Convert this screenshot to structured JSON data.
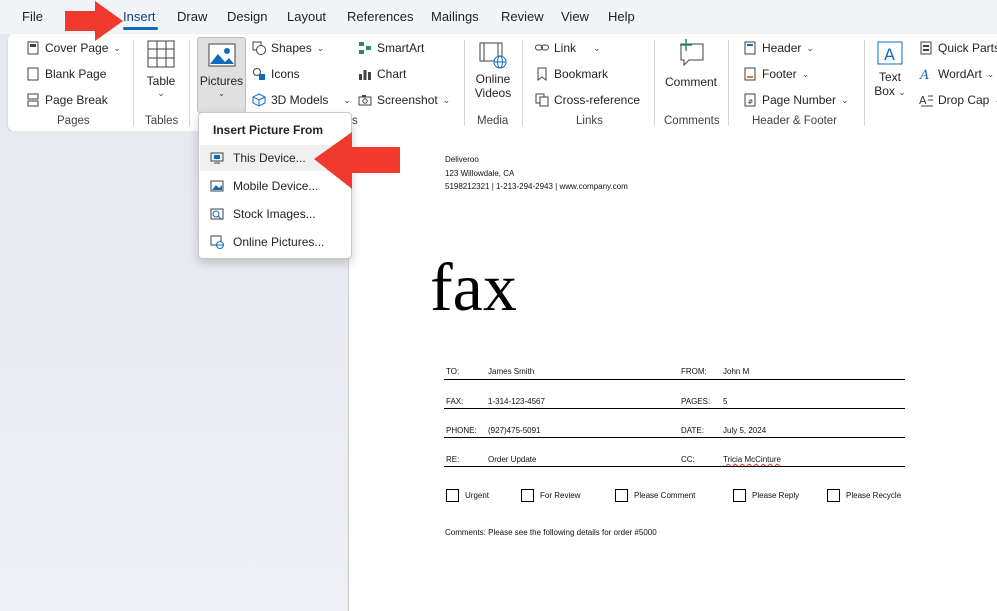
{
  "tabs": [
    {
      "label": "File"
    },
    {
      "label": "Insert"
    },
    {
      "label": "Draw"
    },
    {
      "label": "Design"
    },
    {
      "label": "Layout"
    },
    {
      "label": "References"
    },
    {
      "label": "Mailings"
    },
    {
      "label": "Review"
    },
    {
      "label": "View"
    },
    {
      "label": "Help"
    }
  ],
  "ribbon": {
    "pages": {
      "cover_page": "Cover Page",
      "blank_page": "Blank Page",
      "page_break": "Page Break",
      "label": "Pages"
    },
    "tables": {
      "table": "Table",
      "label": "Tables"
    },
    "illustrations": {
      "pictures": "Pictures",
      "shapes": "Shapes",
      "icons": "Icons",
      "models": "3D Models",
      "smartart": "SmartArt",
      "chart": "Chart",
      "screenshot": "Screenshot",
      "label_fragment": "s"
    },
    "media": {
      "online_videos_1": "Online",
      "online_videos_2": "Videos",
      "label": "Media"
    },
    "links": {
      "link": "Link",
      "bookmark": "Bookmark",
      "cross_reference": "Cross-reference",
      "label": "Links"
    },
    "comments": {
      "comment": "Comment",
      "label": "Comments"
    },
    "header_footer": {
      "header": "Header",
      "footer": "Footer",
      "page_number": "Page Number",
      "label": "Header & Footer"
    },
    "text": {
      "text_box_1": "Text",
      "text_box_2": "Box",
      "quick_parts": "Quick Parts",
      "wordart": "WordArt",
      "drop_cap": "Drop Cap"
    }
  },
  "dropdown": {
    "header": "Insert Picture From",
    "items": [
      {
        "label": "This Device..."
      },
      {
        "label": "Mobile Device..."
      },
      {
        "label": "Stock Images..."
      },
      {
        "label": "Online Pictures..."
      }
    ]
  },
  "document": {
    "company": "Deliveroo",
    "address": "123 Willowdale, CA",
    "contact": "5198212321 | 1-213-294-2943 | www.company.com",
    "title": "fax",
    "fields": [
      {
        "l_label": "TO:",
        "l_value": "James Smith",
        "r_label": "FROM:",
        "r_value": "John M"
      },
      {
        "l_label": "FAX:",
        "l_value": "1-314-123-4567",
        "r_label": "PAGES:",
        "r_value": "5"
      },
      {
        "l_label": "PHONE:",
        "l_value": "(927)475-5091",
        "r_label": "DATE:",
        "r_value": "July 5, 2024"
      },
      {
        "l_label": "RE:",
        "l_value": "Order Update",
        "r_label": "CC:",
        "r_value": "Tricia McCinture"
      }
    ],
    "checkboxes": [
      "Urgent",
      "For Review",
      "Please Comment",
      "Please Reply",
      "Please Recycle"
    ],
    "comments": "Comments:  Please see the following details for order #5000"
  },
  "colors": {
    "accent": "#0f6cbd",
    "arrow": "#f03a2e"
  }
}
